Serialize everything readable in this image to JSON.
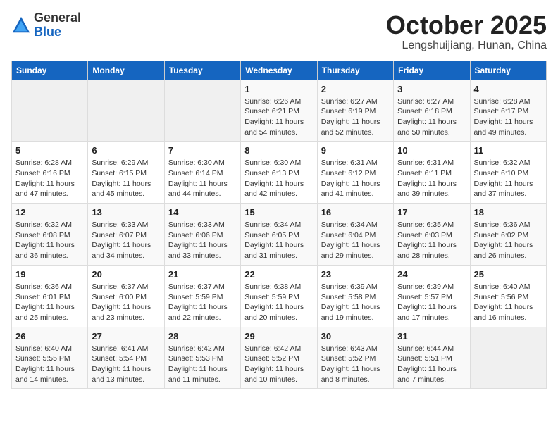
{
  "header": {
    "logo_general": "General",
    "logo_blue": "Blue",
    "title": "October 2025",
    "location": "Lengshuijiang, Hunan, China"
  },
  "weekdays": [
    "Sunday",
    "Monday",
    "Tuesday",
    "Wednesday",
    "Thursday",
    "Friday",
    "Saturday"
  ],
  "weeks": [
    [
      {
        "day": "",
        "info": ""
      },
      {
        "day": "",
        "info": ""
      },
      {
        "day": "",
        "info": ""
      },
      {
        "day": "1",
        "info": "Sunrise: 6:26 AM\nSunset: 6:21 PM\nDaylight: 11 hours\nand 54 minutes."
      },
      {
        "day": "2",
        "info": "Sunrise: 6:27 AM\nSunset: 6:19 PM\nDaylight: 11 hours\nand 52 minutes."
      },
      {
        "day": "3",
        "info": "Sunrise: 6:27 AM\nSunset: 6:18 PM\nDaylight: 11 hours\nand 50 minutes."
      },
      {
        "day": "4",
        "info": "Sunrise: 6:28 AM\nSunset: 6:17 PM\nDaylight: 11 hours\nand 49 minutes."
      }
    ],
    [
      {
        "day": "5",
        "info": "Sunrise: 6:28 AM\nSunset: 6:16 PM\nDaylight: 11 hours\nand 47 minutes."
      },
      {
        "day": "6",
        "info": "Sunrise: 6:29 AM\nSunset: 6:15 PM\nDaylight: 11 hours\nand 45 minutes."
      },
      {
        "day": "7",
        "info": "Sunrise: 6:30 AM\nSunset: 6:14 PM\nDaylight: 11 hours\nand 44 minutes."
      },
      {
        "day": "8",
        "info": "Sunrise: 6:30 AM\nSunset: 6:13 PM\nDaylight: 11 hours\nand 42 minutes."
      },
      {
        "day": "9",
        "info": "Sunrise: 6:31 AM\nSunset: 6:12 PM\nDaylight: 11 hours\nand 41 minutes."
      },
      {
        "day": "10",
        "info": "Sunrise: 6:31 AM\nSunset: 6:11 PM\nDaylight: 11 hours\nand 39 minutes."
      },
      {
        "day": "11",
        "info": "Sunrise: 6:32 AM\nSunset: 6:10 PM\nDaylight: 11 hours\nand 37 minutes."
      }
    ],
    [
      {
        "day": "12",
        "info": "Sunrise: 6:32 AM\nSunset: 6:08 PM\nDaylight: 11 hours\nand 36 minutes."
      },
      {
        "day": "13",
        "info": "Sunrise: 6:33 AM\nSunset: 6:07 PM\nDaylight: 11 hours\nand 34 minutes."
      },
      {
        "day": "14",
        "info": "Sunrise: 6:33 AM\nSunset: 6:06 PM\nDaylight: 11 hours\nand 33 minutes."
      },
      {
        "day": "15",
        "info": "Sunrise: 6:34 AM\nSunset: 6:05 PM\nDaylight: 11 hours\nand 31 minutes."
      },
      {
        "day": "16",
        "info": "Sunrise: 6:34 AM\nSunset: 6:04 PM\nDaylight: 11 hours\nand 29 minutes."
      },
      {
        "day": "17",
        "info": "Sunrise: 6:35 AM\nSunset: 6:03 PM\nDaylight: 11 hours\nand 28 minutes."
      },
      {
        "day": "18",
        "info": "Sunrise: 6:36 AM\nSunset: 6:02 PM\nDaylight: 11 hours\nand 26 minutes."
      }
    ],
    [
      {
        "day": "19",
        "info": "Sunrise: 6:36 AM\nSunset: 6:01 PM\nDaylight: 11 hours\nand 25 minutes."
      },
      {
        "day": "20",
        "info": "Sunrise: 6:37 AM\nSunset: 6:00 PM\nDaylight: 11 hours\nand 23 minutes."
      },
      {
        "day": "21",
        "info": "Sunrise: 6:37 AM\nSunset: 5:59 PM\nDaylight: 11 hours\nand 22 minutes."
      },
      {
        "day": "22",
        "info": "Sunrise: 6:38 AM\nSunset: 5:59 PM\nDaylight: 11 hours\nand 20 minutes."
      },
      {
        "day": "23",
        "info": "Sunrise: 6:39 AM\nSunset: 5:58 PM\nDaylight: 11 hours\nand 19 minutes."
      },
      {
        "day": "24",
        "info": "Sunrise: 6:39 AM\nSunset: 5:57 PM\nDaylight: 11 hours\nand 17 minutes."
      },
      {
        "day": "25",
        "info": "Sunrise: 6:40 AM\nSunset: 5:56 PM\nDaylight: 11 hours\nand 16 minutes."
      }
    ],
    [
      {
        "day": "26",
        "info": "Sunrise: 6:40 AM\nSunset: 5:55 PM\nDaylight: 11 hours\nand 14 minutes."
      },
      {
        "day": "27",
        "info": "Sunrise: 6:41 AM\nSunset: 5:54 PM\nDaylight: 11 hours\nand 13 minutes."
      },
      {
        "day": "28",
        "info": "Sunrise: 6:42 AM\nSunset: 5:53 PM\nDaylight: 11 hours\nand 11 minutes."
      },
      {
        "day": "29",
        "info": "Sunrise: 6:42 AM\nSunset: 5:52 PM\nDaylight: 11 hours\nand 10 minutes."
      },
      {
        "day": "30",
        "info": "Sunrise: 6:43 AM\nSunset: 5:52 PM\nDaylight: 11 hours\nand 8 minutes."
      },
      {
        "day": "31",
        "info": "Sunrise: 6:44 AM\nSunset: 5:51 PM\nDaylight: 11 hours\nand 7 minutes."
      },
      {
        "day": "",
        "info": ""
      }
    ]
  ]
}
